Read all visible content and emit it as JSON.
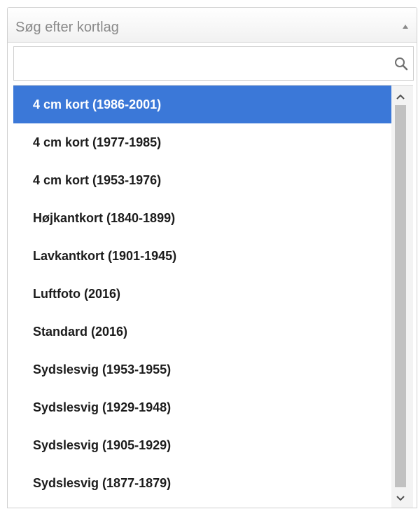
{
  "select": {
    "placeholder": "Søg efter kortlag"
  },
  "search": {
    "value": "",
    "placeholder": ""
  },
  "options": [
    {
      "label": "4 cm kort (1986-2001)",
      "selected": true
    },
    {
      "label": "4 cm kort (1977-1985)",
      "selected": false
    },
    {
      "label": "4 cm kort (1953-1976)",
      "selected": false
    },
    {
      "label": "Højkantkort (1840-1899)",
      "selected": false
    },
    {
      "label": "Lavkantkort (1901-1945)",
      "selected": false
    },
    {
      "label": "Luftfoto (2016)",
      "selected": false
    },
    {
      "label": "Standard (2016)",
      "selected": false
    },
    {
      "label": "Sydslesvig (1953-1955)",
      "selected": false
    },
    {
      "label": "Sydslesvig (1929-1948)",
      "selected": false
    },
    {
      "label": "Sydslesvig (1905-1929)",
      "selected": false
    },
    {
      "label": "Sydslesvig (1877-1879)",
      "selected": false
    }
  ],
  "colors": {
    "selected_bg": "#3b78d8",
    "selected_text": "#ffffff",
    "option_text": "#1c1c1c"
  },
  "icons": {
    "caret": "caret-up-icon",
    "search": "search-icon",
    "scroll_up": "chevron-up-icon",
    "scroll_down": "chevron-down-icon"
  }
}
